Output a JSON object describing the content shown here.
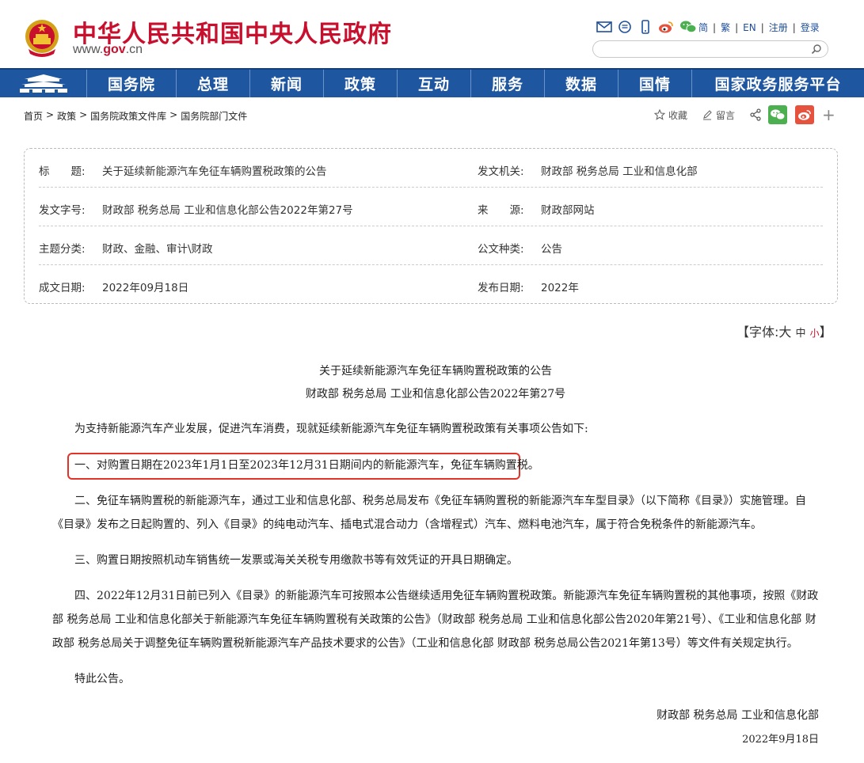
{
  "header": {
    "site_title": "中华人民共和国中央人民政府",
    "domain_prefix": "www.",
    "domain_main": "gov",
    "domain_suffix": ".cn",
    "lang": {
      "simplified": "简",
      "traditional": "繁",
      "english": "EN",
      "register": "注册",
      "login": "登录"
    },
    "search_placeholder": ""
  },
  "nav": {
    "items": [
      "国务院",
      "总理",
      "新闻",
      "政策",
      "互动",
      "服务",
      "数据",
      "国情",
      "国家政务服务平台"
    ]
  },
  "breadcrumb": {
    "items": [
      "首页",
      "政策",
      "国务院政策文件库",
      "国务院部门文件"
    ],
    "separator": ">"
  },
  "tools": {
    "favorite": "收藏",
    "message": "留言",
    "plus": "+"
  },
  "meta": {
    "title_label": "标　　题:",
    "title_value": "关于延续新能源汽车免征车辆购置税政策的公告",
    "issuer_label": "发文机关:",
    "issuer_value": "财政部 税务总局 工业和信息化部",
    "docno_label": "发文字号:",
    "docno_value": "财政部 税务总局 工业和信息化部公告2022年第27号",
    "source_label": "来　　源:",
    "source_value": "财政部网站",
    "topic_label": "主题分类:",
    "topic_value": "财政、金融、审计\\财政",
    "type_label": "公文种类:",
    "type_value": "公告",
    "created_label": "成文日期:",
    "created_value": "2022年09月18日",
    "published_label": "发布日期:",
    "published_value": "2022年"
  },
  "fontsize": {
    "prefix": "【字体:",
    "large": "大",
    "medium": "中",
    "small": "小",
    "suffix": "】"
  },
  "article": {
    "title": "关于延续新能源汽车免征车辆购置税政策的公告",
    "subtitle": "财政部 税务总局 工业和信息化部公告2022年第27号",
    "intro": "为支持新能源汽车产业发展，促进汽车消费，现就延续新能源汽车免征车辆购置税政策有关事项公告如下:",
    "p1": "一、对购置日期在2023年1月1日至2023年12月31日期间内的新能源汽车，免征车辆购置税。",
    "p2": "二、免征车辆购置税的新能源汽车，通过工业和信息化部、税务总局发布《免征车辆购置税的新能源汽车车型目录》（以下简称《目录》）实施管理。自《目录》发布之日起购置的、列入《目录》的纯电动汽车、插电式混合动力（含增程式）汽车、燃料电池汽车，属于符合免税条件的新能源汽车。",
    "p3": "三、购置日期按照机动车销售统一发票或海关关税专用缴款书等有效凭证的开具日期确定。",
    "p4": "四、2022年12月31日前已列入《目录》的新能源汽车可按照本公告继续适用免征车辆购置税政策。新能源汽车免征车辆购置税的其他事项，按照《财政部 税务总局 工业和信息化部关于新能源汽车免征车辆购置税有关政策的公告》（财政部 税务总局 工业和信息化部公告2020年第21号）、《工业和信息化部 财政部 税务总局关于调整免征车辆购置税新能源汽车产品技术要求的公告》（工业和信息化部 财政部 税务总局公告2021年第13号）等文件有关规定执行。",
    "p5": "特此公告。",
    "signer": "财政部 税务总局 工业和信息化部",
    "sign_date": "2022年9月18日"
  },
  "colors": {
    "brand_red": "#c8102e",
    "nav_blue": "#1e56a0",
    "highlight_red": "#e2332a",
    "wechat_green": "#4caf50",
    "weibo_red": "#e5533f"
  },
  "icons": [
    "national-emblem-icon",
    "mail-icon",
    "chat-icon",
    "mobile-icon",
    "weibo-icon",
    "wechat-icon",
    "search-icon",
    "tiananmen-icon",
    "star-icon",
    "pencil-icon",
    "share-icon"
  ]
}
